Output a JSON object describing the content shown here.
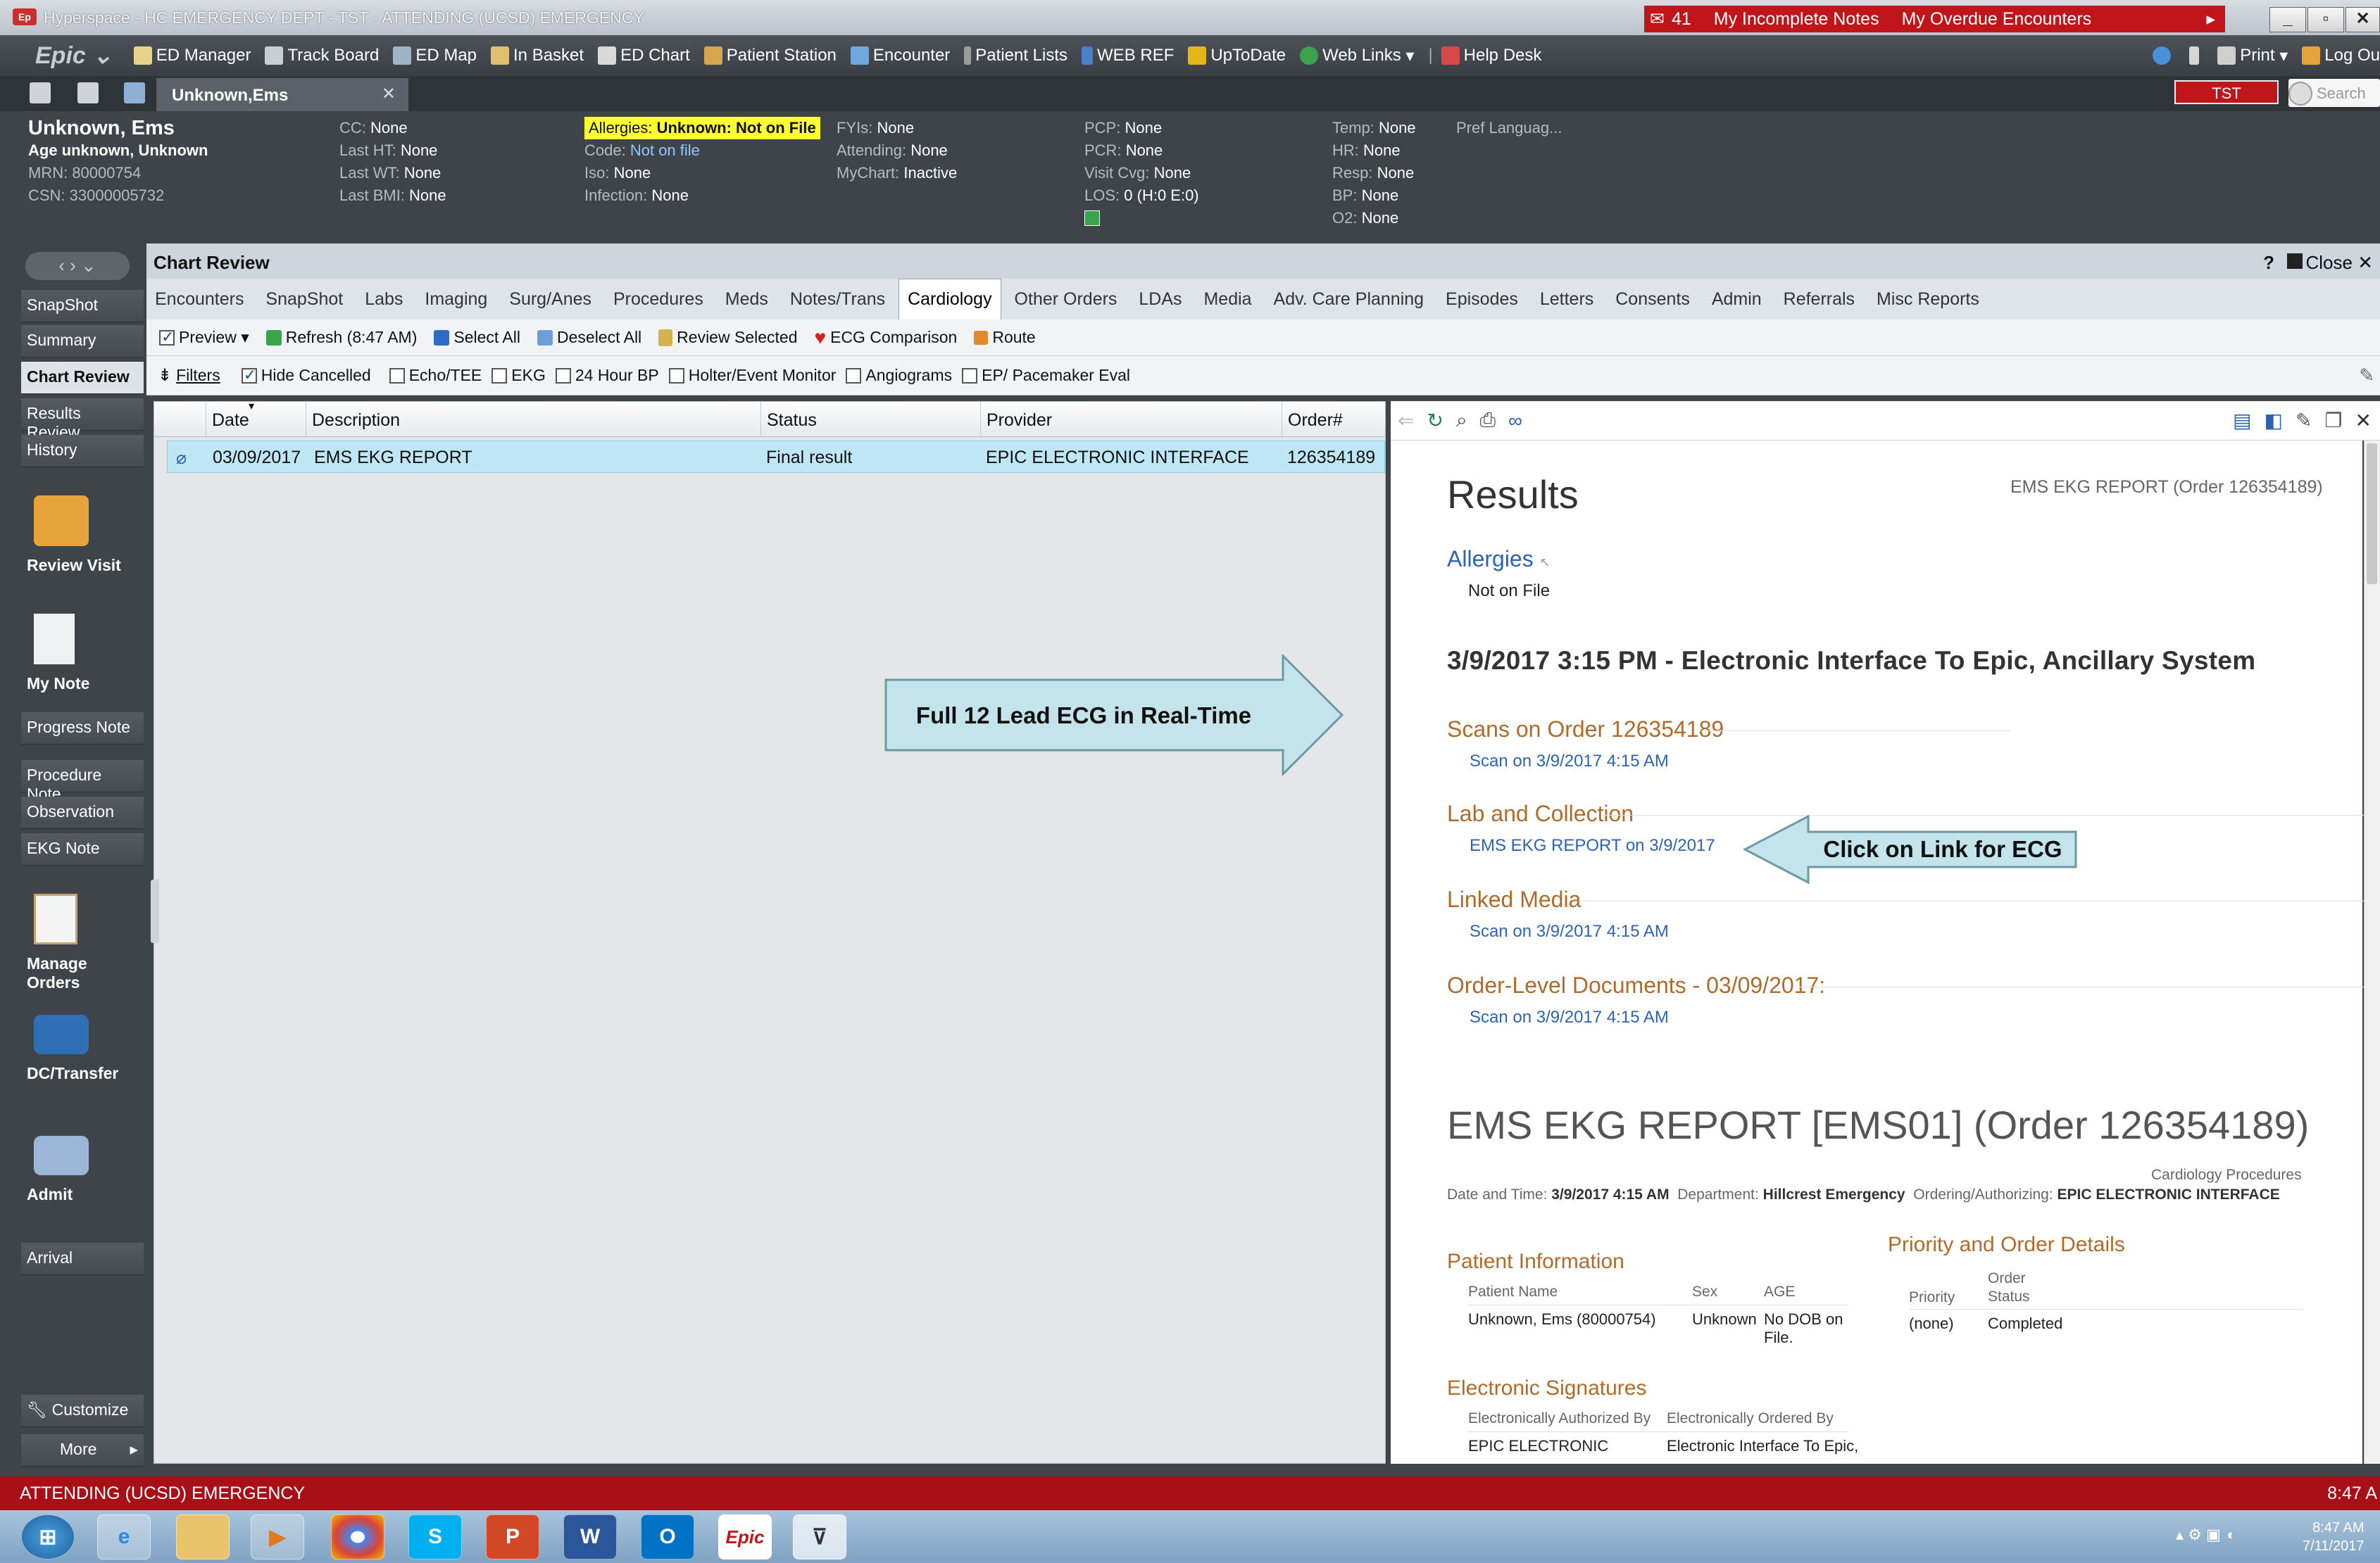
{
  "window": {
    "title": "Hyperspace - HC EMERGENCY DEPT - TST - ATTENDING (UCSD) EMERGENCY",
    "notifications": {
      "count": "41",
      "incomplete_notes": "My Incomplete Notes",
      "overdue": "My Overdue Encounters"
    }
  },
  "toolbar": {
    "logo": "Epic",
    "items": [
      "ED Manager",
      "Track Board",
      "ED Map",
      "In Basket",
      "ED Chart",
      "Patient Station",
      "Encounter",
      "Patient Lists",
      "WEB REF",
      "UpToDate",
      "Web Links",
      "Help Desk"
    ],
    "print": "Print",
    "logout": "Log Ou"
  },
  "tabstrip": {
    "patient_tab": "Unknown,Ems",
    "env": "TST",
    "search_placeholder": "Search"
  },
  "patient": {
    "name": "Unknown, Ems",
    "age": "Age unknown, Unknown",
    "mrn": "MRN: 80000754",
    "csn": "CSN: 33000005732",
    "cc_label": "CC:",
    "cc": "None",
    "ht_label": "Last HT:",
    "ht": "None",
    "wt_label": "Last WT:",
    "wt": "None",
    "bmi_label": "Last BMI:",
    "bmi": "None",
    "allergies_label": "Allergies:",
    "allergies": "Unknown: Not on File",
    "code_label": "Code:",
    "code": "Not on file",
    "iso_label": "Iso:",
    "iso": "None",
    "infection_label": "Infection:",
    "infection": "None",
    "fyis_label": "FYIs:",
    "fyis": "None",
    "attending_label": "Attending:",
    "attending": "None",
    "mychart_label": "MyChart:",
    "mychart": "Inactive",
    "pcp_label": "PCP:",
    "pcp": "None",
    "pcr_label": "PCR:",
    "pcr": "None",
    "visit_label": "Visit Cvg:",
    "visit": "None",
    "los_label": "LOS:",
    "los": "0 (H:0 E:0)",
    "temp_label": "Temp:",
    "temp": "None",
    "hr_label": "HR:",
    "hr": "None",
    "resp_label": "Resp:",
    "resp": "None",
    "bp_label": "BP:",
    "bp": "None",
    "o2_label": "O2:",
    "o2": "None",
    "pref_lang": "Pref Languag..."
  },
  "sidebar": {
    "items": [
      "SnapShot",
      "Summary",
      "Chart Review",
      "Results Review",
      "History"
    ],
    "review_visit": "Review Visit",
    "my_note": "My Note",
    "notes": [
      "Progress Note",
      "Procedure Note",
      "Observation",
      "EKG Note"
    ],
    "manage_orders": "Manage Orders",
    "dc_transfer": "DC/Transfer",
    "admit": "Admit",
    "arrival": "Arrival",
    "customize": "Customize",
    "more": "More"
  },
  "chart_review": {
    "title": "Chart Review",
    "help": "?",
    "close": "Close",
    "tabs": [
      "Encounters",
      "SnapShot",
      "Labs",
      "Imaging",
      "Surg/Anes",
      "Procedures",
      "Meds",
      "Notes/Trans",
      "Cardiology",
      "Other Orders",
      "LDAs",
      "Media",
      "Adv. Care Planning",
      "Episodes",
      "Letters",
      "Consents",
      "Admin",
      "Referrals",
      "Misc Reports"
    ],
    "active_tab": "Cardiology",
    "actions": {
      "preview": "Preview",
      "refresh": "Refresh (8:47 AM)",
      "select_all": "Select All",
      "deselect_all": "Deselect All",
      "review_selected": "Review Selected",
      "ecg_comparison": "ECG Comparison",
      "route": "Route"
    },
    "filters": {
      "label": "Filters",
      "hide_cancelled": "Hide Cancelled",
      "echo": "Echo/TEE",
      "ekg": "EKG",
      "bp24": "24 Hour BP",
      "holter": "Holter/Event Monitor",
      "angio": "Angiograms",
      "ep": "EP/ Pacemaker Eval"
    },
    "columns": [
      "Date",
      "Description",
      "Status",
      "Provider",
      "Order#"
    ],
    "rows": [
      {
        "date": "03/09/2017",
        "description": "EMS EKG REPORT",
        "status": "Final result",
        "provider": "EPIC ELECTRONIC INTERFACE",
        "order": "126354189"
      }
    ]
  },
  "preview": {
    "results_title": "Results",
    "report_ref": "EMS EKG REPORT (Order 126354189)",
    "allergies_title": "Allergies",
    "allergies_value": "Not on File",
    "event_title": "3/9/2017  3:15 PM - Electronic Interface To Epic, Ancillary System",
    "scans_title": "Scans on Order 126354189",
    "scan_link": "Scan on 3/9/2017  4:15 AM",
    "lab_title": "Lab and Collection",
    "lab_link": "EMS EKG REPORT on 3/9/2017",
    "linked_title": "Linked Media",
    "linked_link": "Scan on 3/9/2017  4:15 AM",
    "orderdocs_title": "Order-Level Documents - 03/09/2017:",
    "orderdocs_link": "Scan on 3/9/2017  4:15 AM",
    "report_title": "EMS EKG REPORT [EMS01] (Order 126354189)",
    "category": "Cardiology Procedures",
    "dt_label": "Date and Time:",
    "dt_value": "3/9/2017  4:15 AM",
    "dept_label": "Department:",
    "dept_value": "Hillcrest Emergency",
    "ord_label": "Ordering/Authorizing:",
    "ord_value": "EPIC ELECTRONIC INTERFACE",
    "patient_info_title": "Patient Information",
    "pi_cols": [
      "Patient Name",
      "Sex",
      "AGE"
    ],
    "pi_values": [
      "Unknown, Ems (80000754)",
      "Unknown",
      "No DOB on File."
    ],
    "priority_title": "Priority and Order Details",
    "pr_cols": [
      "Priority",
      "Order Status"
    ],
    "pr_values": [
      "(none)",
      "Completed"
    ],
    "sig_title": "Electronic Signatures",
    "sig_cols": [
      "Electronically Authorized By",
      "Electronically Ordered By"
    ],
    "sig_values": [
      "EPIC ELECTRONIC",
      "Electronic Interface To Epic,"
    ]
  },
  "annotations": {
    "arrow1": "Full 12 Lead ECG in Real-Time",
    "arrow2": "Click on Link for ECG"
  },
  "statusbar": {
    "role": "ATTENDING (UCSD) EMERGENCY",
    "time": "8:47 A"
  },
  "taskbar": {
    "time": "8:47 AM",
    "date": "7/11/2017"
  },
  "colors": {
    "accent_red": "#c0161b",
    "status_red": "#a80f16",
    "selected_row": "#bfe6f4",
    "section_orange": "#b06a2a",
    "link_blue": "#2d63b0",
    "callout_fill": "#c3e4ea"
  }
}
